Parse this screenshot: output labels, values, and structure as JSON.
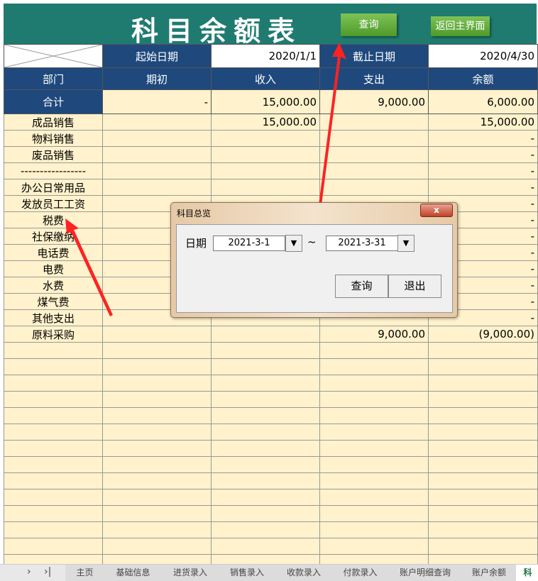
{
  "title": "科目余额表",
  "buttons": {
    "query": "查询",
    "home": "返回主界面"
  },
  "dates": {
    "start_label": "起始日期",
    "start_value": "2020/1/1",
    "end_label": "截止日期",
    "end_value": "2020/4/30"
  },
  "headers": [
    "部门",
    "期初",
    "收入",
    "支出",
    "余额"
  ],
  "total": {
    "label": "合计",
    "opening": "-",
    "income": "15,000.00",
    "expense": "9,000.00",
    "balance": "6,000.00"
  },
  "rows": [
    {
      "name": "成品销售",
      "opening": "",
      "income": "15,000.00",
      "expense": "",
      "balance": "15,000.00"
    },
    {
      "name": "物料销售",
      "opening": "",
      "income": "",
      "expense": "",
      "balance": "-"
    },
    {
      "name": "废品销售",
      "opening": "",
      "income": "",
      "expense": "",
      "balance": "-"
    },
    {
      "name": "-----------------",
      "opening": "",
      "income": "",
      "expense": "",
      "balance": "-"
    },
    {
      "name": "办公日常用品",
      "opening": "",
      "income": "",
      "expense": "",
      "balance": "-"
    },
    {
      "name": "发放员工工资",
      "opening": "",
      "income": "",
      "expense": "",
      "balance": "-"
    },
    {
      "name": "税费",
      "opening": "",
      "income": "",
      "expense": "",
      "balance": "-"
    },
    {
      "name": "社保缴纳",
      "opening": "",
      "income": "",
      "expense": "",
      "balance": "-"
    },
    {
      "name": "电话费",
      "opening": "",
      "income": "",
      "expense": "",
      "balance": "-"
    },
    {
      "name": "电费",
      "opening": "",
      "income": "",
      "expense": "",
      "balance": "-"
    },
    {
      "name": "水费",
      "opening": "",
      "income": "",
      "expense": "",
      "balance": "-"
    },
    {
      "name": "煤气费",
      "opening": "",
      "income": "",
      "expense": "",
      "balance": "-"
    },
    {
      "name": "其他支出",
      "opening": "",
      "income": "",
      "expense": "",
      "balance": "-"
    },
    {
      "name": "原料采购",
      "opening": "",
      "income": "",
      "expense": "9,000.00",
      "balance": "(9,000.00)"
    }
  ],
  "dialog": {
    "title": "科目总览",
    "close": "x",
    "date_label": "日期",
    "from": "2021-3-1",
    "tilde": "~",
    "to": "2021-3-31",
    "query": "查询",
    "exit": "退出"
  },
  "tabs": [
    "主页",
    "基础信息",
    "进货录入",
    "销售录入",
    "收款录入",
    "付款录入",
    "账户明细查询",
    "账户余额",
    "科"
  ],
  "nav": {
    "next": "›",
    "last": "›|"
  }
}
